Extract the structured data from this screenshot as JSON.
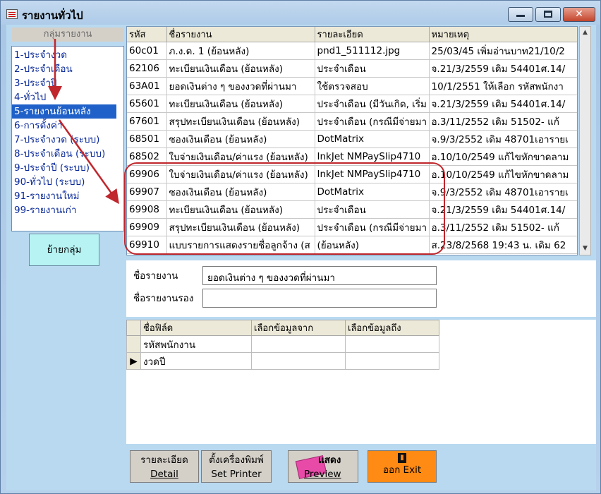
{
  "window": {
    "title": "รายงานทั่วไป",
    "close_glyph": "✕"
  },
  "sidebar": {
    "header": "กลุ่มรายงาน",
    "items": [
      {
        "label": "1-ประจำงวด"
      },
      {
        "label": "2-ประจำเดือน"
      },
      {
        "label": "3-ประจำปี"
      },
      {
        "label": "4-ทั่วไป"
      },
      {
        "label": "5-รายงานย้อนหลัง"
      },
      {
        "label": "6-การตั้งค่า"
      },
      {
        "label": "7-ประจำงวด (ระบบ)"
      },
      {
        "label": "8-ประจำเดือน (ระบบ)"
      },
      {
        "label": "9-ประจำปี (ระบบ)"
      },
      {
        "label": "90-ทั่วไป (ระบบ)"
      },
      {
        "label": "91-รายงานใหม่"
      },
      {
        "label": "99-รายงานเก่า"
      }
    ],
    "selected_index": 4,
    "move_button": "ย้ายกลุ่ม"
  },
  "report_grid": {
    "columns": [
      "รหัส",
      "ชื่อรายงาน",
      "รายละเอียด",
      "หมายเหตุ"
    ],
    "rows": [
      [
        "60c01",
        "ภ.ง.ด. 1 (ย้อนหลัง)",
        "pnd1_511112.jpg",
        "25/03/45  เพิ่มอ่านบาท21/10/2"
      ],
      [
        "62106",
        "ทะเบียนเงินเดือน (ย้อนหลัง)",
        "ประจำเดือน",
        "จ.21/3/2559 เดิม 54401ศ.14/"
      ],
      [
        "63A01",
        "ยอดเงินต่าง ๆ ของงวดที่ผ่านมา",
        "ใช้ตรวจสอบ",
        "10/1/2551  ให้เลือก รหัสพนักงา"
      ],
      [
        "65601",
        "ทะเบียนเงินเดือน (ย้อนหลัง)",
        "ประจำเดือน (มีวันเกิด, เริ่ม",
        "จ.21/3/2559 เดิม 54401ศ.14/"
      ],
      [
        "67601",
        "สรุปทะเบียนเงินเดือน (ย้อนหลัง)",
        "ประจำเดือน (กรณีมีจ่ายมา",
        "อ.3/11/2552  เดิม  51502- แก้"
      ],
      [
        "68501",
        "ซองเงินเดือน (ย้อนหลัง)",
        "DotMatrix",
        "จ.9/3/2552 เดิม 48701เอารายเ"
      ],
      [
        "68502",
        "ใบจ่ายเงินเดือน/ค่าแรง (ย้อนหลัง)",
        "InkJet NMPaySlip4710",
        "อ.10/10/2549  แก้ไขหักขาดลาม"
      ],
      [
        "69906",
        "ใบจ่ายเงินเดือน/ค่าแรง (ย้อนหลัง)",
        "InkJet NMPaySlip4710",
        "อ.10/10/2549  แก้ไขหักขาดลาม"
      ],
      [
        "69907",
        "ซองเงินเดือน (ย้อนหลัง)",
        "DotMatrix",
        "จ.9/3/2552 เดิม 48701เอารายเ"
      ],
      [
        "69908",
        "ทะเบียนเงินเดือน (ย้อนหลัง)",
        "ประจำเดือน",
        "จ.21/3/2559 เดิม 54401ศ.14/"
      ],
      [
        "69909",
        "สรุปทะเบียนเงินเดือน (ย้อนหลัง)",
        "ประจำเดือน (กรณีมีจ่ายมา",
        "อ.3/11/2552  เดิม  51502- แก้"
      ],
      [
        "69910",
        "แบบรายการแสดงรายชื่อลูกจ้าง  (ส",
        "(ย้อนหลัง)",
        "ส.23/8/2568  19:43 น. เดิม 62"
      ]
    ]
  },
  "name_section": {
    "report_name_label": "ชื่อรายงาน",
    "report_name_value": "ยอดเงินต่าง ๆ ของงวดที่ผ่านมา",
    "sub_name_label": "ชื่อรายงานรอง",
    "sub_name_value": ""
  },
  "field_grid": {
    "columns": [
      "ชื่อฟิล์ด",
      "เลือกข้อมูลจาก",
      "เลือกข้อมูลถึง"
    ],
    "rows": [
      {
        "name": "รหัสพนักงาน",
        "from": "",
        "to": "",
        "marker": ""
      },
      {
        "name": "งวดปี",
        "from": "",
        "to": "",
        "marker": "▶"
      }
    ]
  },
  "buttons": {
    "detail_th": "รายละเอียด",
    "detail_en": "Detail",
    "printer_th": "ตั้งเครื่องพิมพ์",
    "printer_en": "Set Printer",
    "preview_th": "แสดง",
    "preview_en": "Preview",
    "exit_label": "ออก  Exit"
  },
  "colors": {
    "highlight": "#c0262c",
    "arrow": "#c0262c",
    "selected": "#1f61c9",
    "exit_button": "#ff8a14"
  }
}
